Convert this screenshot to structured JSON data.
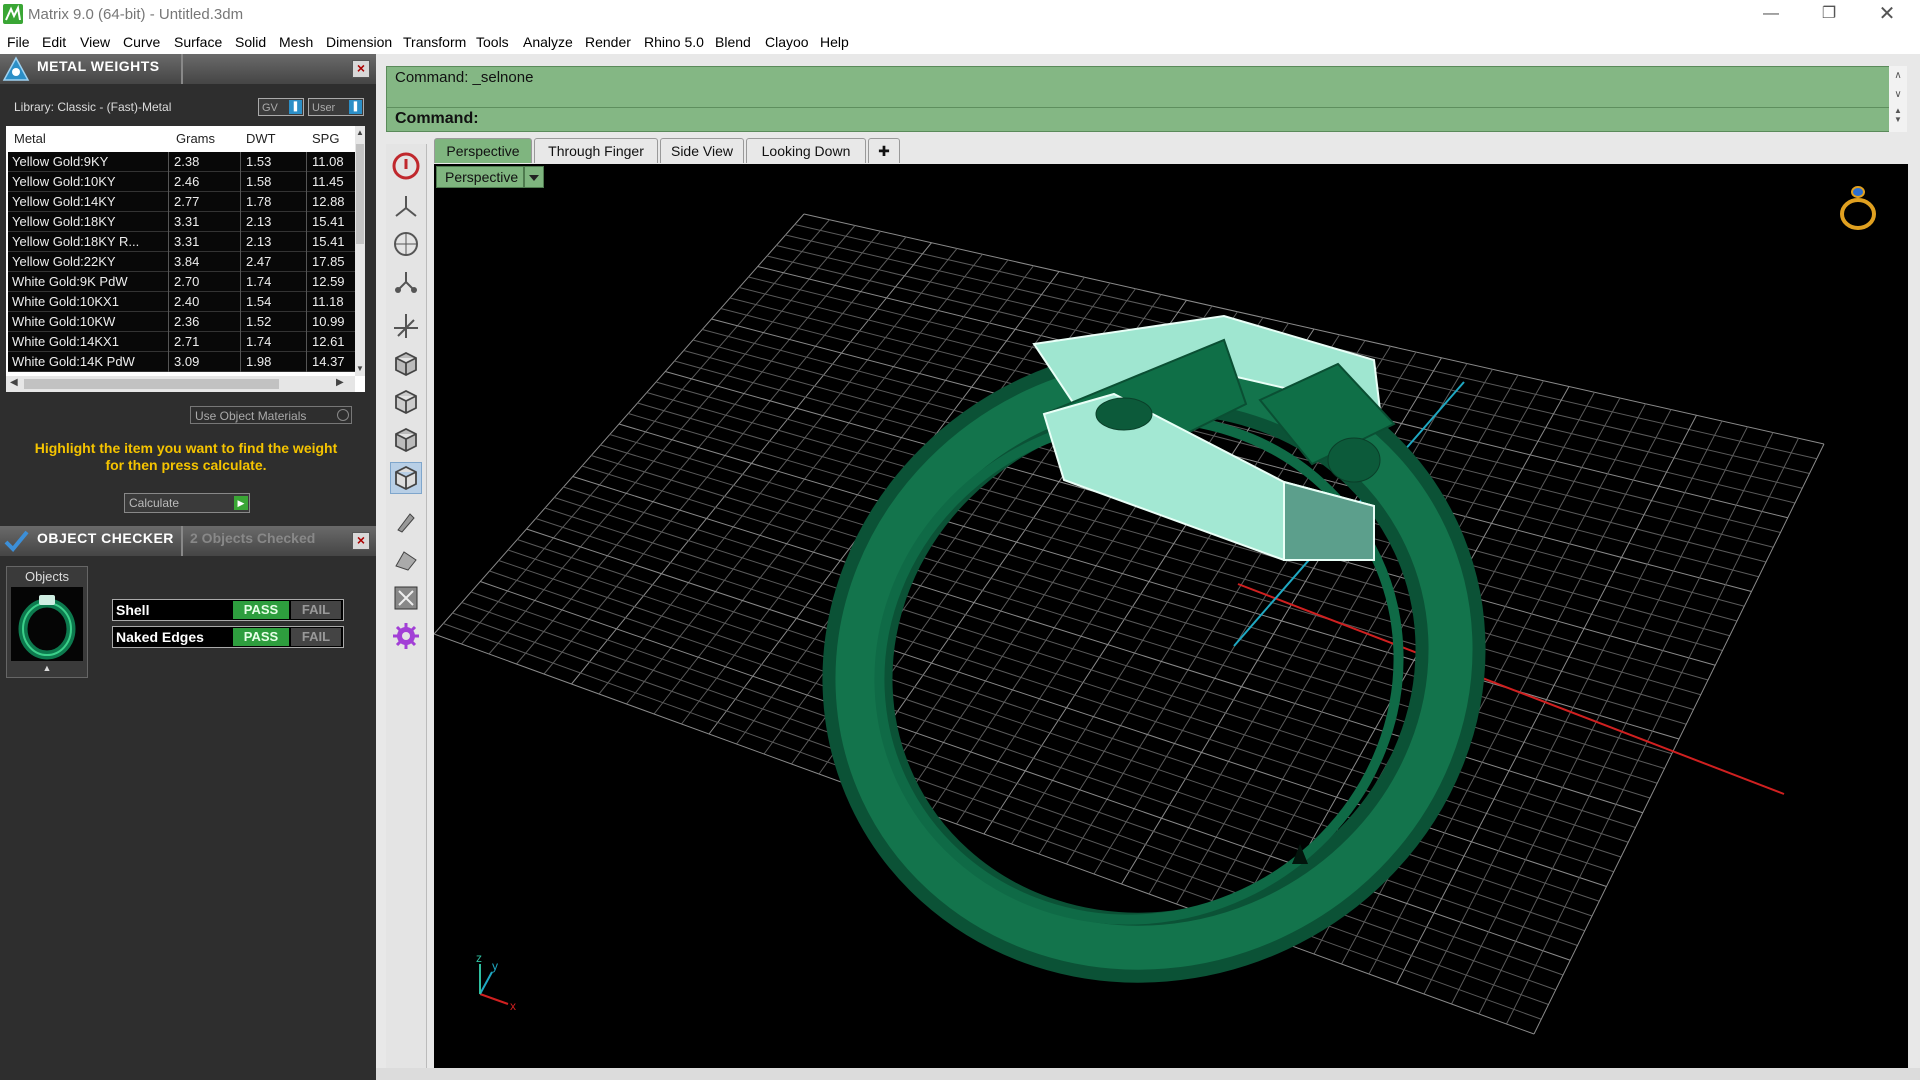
{
  "window": {
    "title": "Matrix 9.0 (64-bit) - Untitled.3dm",
    "controls": [
      "minimize-icon",
      "restore-icon",
      "close-icon"
    ]
  },
  "menu": [
    "File",
    "Edit",
    "View",
    "Curve",
    "Surface",
    "Solid",
    "Mesh",
    "Dimension",
    "Transform",
    "Tools",
    "Analyze",
    "Render",
    "Rhino 5.0",
    "Blend",
    "Clayoo",
    "Help"
  ],
  "metal_weights": {
    "title": "METAL WEIGHTS",
    "library_label": "Library: Classic - (Fast)-Metal",
    "gv_label": "GV",
    "user_label": "User",
    "columns": [
      "Metal",
      "Grams",
      "DWT",
      "SPG"
    ],
    "rows": [
      {
        "metal": "Yellow Gold:9KY",
        "grams": "2.38",
        "dwt": "1.53",
        "spg": "11.08"
      },
      {
        "metal": "Yellow Gold:10KY",
        "grams": "2.46",
        "dwt": "1.58",
        "spg": "11.45"
      },
      {
        "metal": "Yellow Gold:14KY",
        "grams": "2.77",
        "dwt": "1.78",
        "spg": "12.88"
      },
      {
        "metal": "Yellow Gold:18KY",
        "grams": "3.31",
        "dwt": "2.13",
        "spg": "15.41"
      },
      {
        "metal": "Yellow Gold:18KY R...",
        "grams": "3.31",
        "dwt": "2.13",
        "spg": "15.41"
      },
      {
        "metal": "Yellow Gold:22KY",
        "grams": "3.84",
        "dwt": "2.47",
        "spg": "17.85"
      },
      {
        "metal": "White Gold:9K PdW",
        "grams": "2.70",
        "dwt": "1.74",
        "spg": "12.59"
      },
      {
        "metal": "White Gold:10KX1",
        "grams": "2.40",
        "dwt": "1.54",
        "spg": "11.18"
      },
      {
        "metal": "White Gold:10KW",
        "grams": "2.36",
        "dwt": "1.52",
        "spg": "10.99"
      },
      {
        "metal": "White Gold:14KX1",
        "grams": "2.71",
        "dwt": "1.74",
        "spg": "12.61"
      },
      {
        "metal": "White Gold:14K PdW",
        "grams": "3.09",
        "dwt": "1.98",
        "spg": "14.37"
      }
    ],
    "use_object_materials": "Use Object Materials",
    "instruction_line1": "Highlight the item you want to find the weight",
    "instruction_line2": "for then press calculate.",
    "calculate": "Calculate"
  },
  "object_checker": {
    "title": "OBJECT CHECKER",
    "count_label": "2  Objects Checked",
    "objects_label": "Objects",
    "checks": [
      {
        "name": "Shell",
        "pass": "PASS",
        "fail": "FAIL"
      },
      {
        "name": "Naked Edges",
        "pass": "PASS",
        "fail": "FAIL"
      }
    ]
  },
  "command": {
    "history": "Command: _selnone",
    "prompt": "Command:"
  },
  "viewport_tabs": [
    "Perspective",
    "Through Finger",
    "Side View",
    "Looking Down"
  ],
  "viewport": {
    "label": "Perspective",
    "axis_labels": {
      "x": "x",
      "y": "y",
      "z": "z"
    }
  },
  "colors": {
    "accent_green": "#7fb57f",
    "ring_green": "#0e5f3e",
    "selected_cyan": "#9fe6d0",
    "pass_green": "#2e9e3e",
    "warning_yellow": "#f5c400"
  },
  "toolbar_icons": [
    "stop-icon",
    "axis-icon",
    "globe-icon",
    "tree-icon",
    "gumball-icon",
    "cube-top-icon",
    "cube-front-icon",
    "cube-side-icon",
    "cube-persp-icon",
    "brush-icon",
    "clay-icon",
    "frame-icon",
    "gear-purple-icon"
  ]
}
